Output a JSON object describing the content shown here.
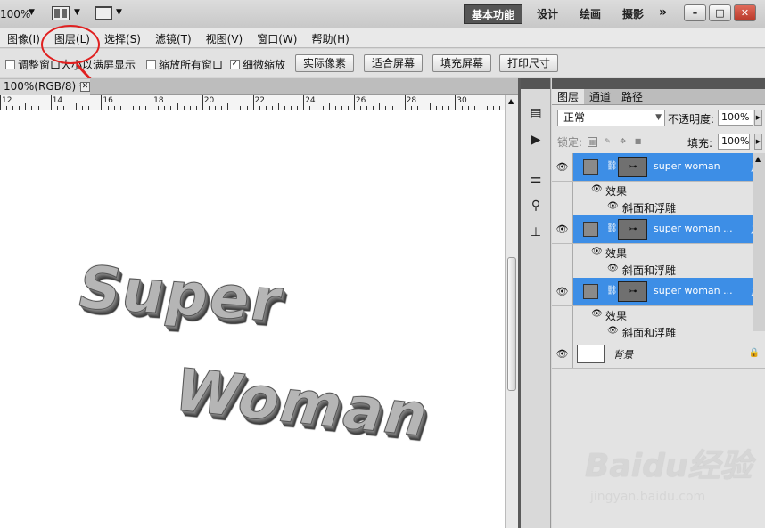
{
  "appbar": {
    "zoom": "100%",
    "workspaces": [
      {
        "label": "基本功能",
        "active": true
      },
      {
        "label": "设计",
        "active": false
      },
      {
        "label": "绘画",
        "active": false
      },
      {
        "label": "摄影",
        "active": false
      }
    ],
    "more": "»"
  },
  "menubar": {
    "items": [
      "图像(I)",
      "图层(L)",
      "选择(S)",
      "滤镜(T)",
      "视图(V)",
      "窗口(W)",
      "帮助(H)"
    ]
  },
  "options": {
    "resize_window": "调整窗口大小以满屏显示",
    "zoom_all": "缩放所有窗口",
    "scrubby_zoom": "细微缩放",
    "actual_pixels": "实际像素",
    "fit_screen": "适合屏幕",
    "fill_screen": "填充屏幕",
    "print_size": "打印尺寸"
  },
  "document": {
    "tab_title": "100%(RGB/8) *",
    "ruler_labels": [
      "12",
      "14",
      "16",
      "18",
      "20",
      "22",
      "24",
      "26",
      "28",
      "30"
    ],
    "art_line1": "Super",
    "art_line2": "Woman"
  },
  "layers_panel": {
    "tabs": [
      "图层",
      "通道",
      "路径"
    ],
    "blend_mode": "正常",
    "opacity_label": "不透明度:",
    "opacity_value": "100%",
    "lock_label": "锁定:",
    "fill_label": "填充:",
    "fill_value": "100%",
    "layers": [
      {
        "name": "super woman",
        "effects_label": "效果",
        "effect": "斜面和浮雕"
      },
      {
        "name": "super woman ...",
        "effects_label": "效果",
        "effect": "斜面和浮雕"
      },
      {
        "name": "super woman ...",
        "effects_label": "效果",
        "effect": "斜面和浮雕"
      }
    ],
    "background_name": "背景",
    "fx_label": "fx"
  },
  "watermark": {
    "main": "Baidu经验",
    "sub": "jingyan.baidu.com"
  },
  "colors": {
    "selection": "#3d8ee6",
    "annotation": "#e02020"
  }
}
